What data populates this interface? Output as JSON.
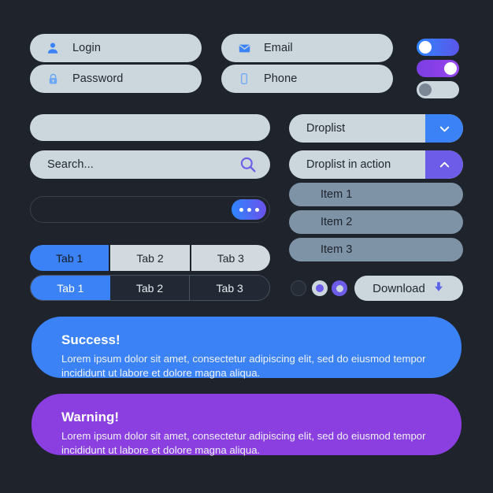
{
  "theme": {
    "background": "#1e232c",
    "field_bg": "#ccd6dd",
    "accent_blue": "#3b82f6",
    "accent_purple": "#6c5ce7",
    "alert_success": "#3b82f6",
    "alert_warning": "#8b3fe0",
    "item_bg": "#7e93a6"
  },
  "fields": {
    "login": {
      "label": "Login",
      "icon": "user-icon"
    },
    "password": {
      "label": "Password",
      "icon": "lock-icon"
    },
    "email": {
      "label": "Email",
      "icon": "envelope-icon"
    },
    "phone": {
      "label": "Phone",
      "icon": "mobile-phone-icon"
    },
    "plain": {
      "value": ""
    },
    "search": {
      "placeholder": "Search...",
      "icon": "search-icon"
    },
    "dots": {
      "value": "",
      "icon": "three-dots-icon"
    }
  },
  "toggles": [
    {
      "name": "toggle-blue",
      "state": "off",
      "colors": [
        "#2f86ff",
        "#5b55e8"
      ]
    },
    {
      "name": "toggle-purple",
      "state": "on",
      "colors": [
        "#7b3fe4",
        "#9b4df0"
      ]
    },
    {
      "name": "toggle-disabled",
      "state": "off",
      "colors": [
        "#ccd6dd",
        "#ccd6dd"
      ]
    }
  ],
  "droplists": {
    "closed": {
      "label": "Droplist",
      "icon": "chevron-down-icon",
      "button_color": "#3b82f6"
    },
    "open": {
      "label": "Droplist in action",
      "icon": "chevron-up-icon",
      "button_color": "#6c5ce7"
    },
    "items": [
      {
        "label": "Item 1"
      },
      {
        "label": "Item 2"
      },
      {
        "label": "Item 3"
      }
    ]
  },
  "tabs_light": {
    "items": [
      {
        "label": "Tab 1",
        "active": true
      },
      {
        "label": "Tab 2",
        "active": false
      },
      {
        "label": "Tab 3",
        "active": false
      }
    ]
  },
  "tabs_dark": {
    "items": [
      {
        "label": "Tab 1",
        "active": true
      },
      {
        "label": "Tab 2",
        "active": false
      },
      {
        "label": "Tab 3",
        "active": false
      }
    ]
  },
  "radios": [
    {
      "name": "radio-unselected",
      "state": "unselected"
    },
    {
      "name": "radio-selected-light",
      "state": "selected"
    },
    {
      "name": "radio-selected-filled",
      "state": "selected"
    }
  ],
  "download": {
    "label": "Download",
    "icon": "download-arrow-icon"
  },
  "alerts": {
    "success": {
      "title": "Success!",
      "body": "Lorem ipsum dolor sit amet, consectetur adipiscing elit, sed do eiusmod tempor incididunt ut labore et dolore magna aliqua."
    },
    "warning": {
      "title": "Warning!",
      "body": "Lorem ipsum dolor sit amet, consectetur adipiscing elit, sed do eiusmod tempor incididunt ut labore et dolore magna aliqua."
    }
  }
}
